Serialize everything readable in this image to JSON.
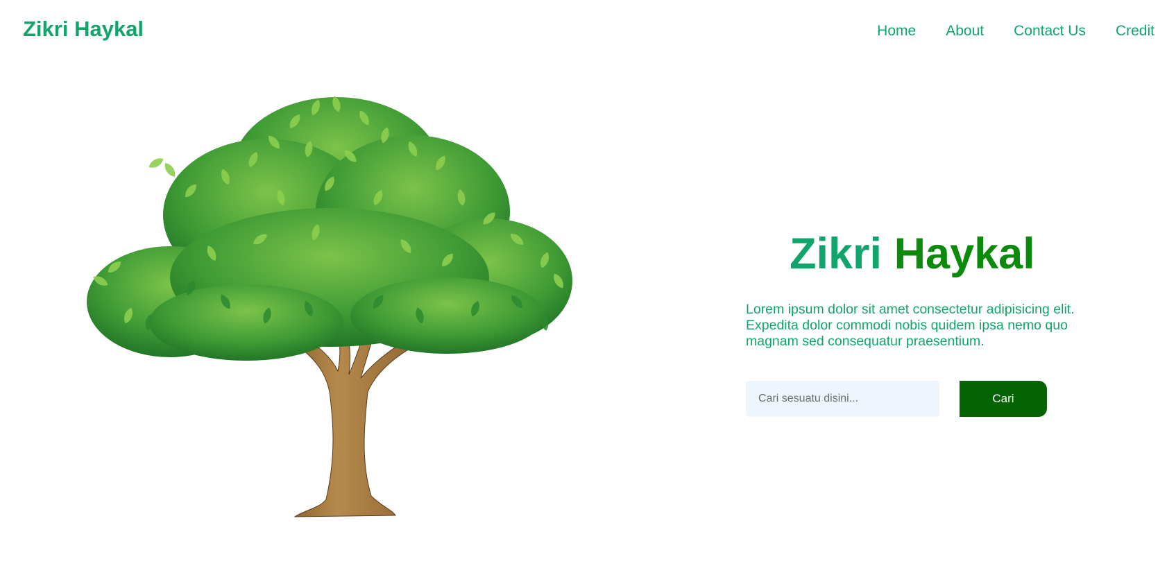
{
  "header": {
    "brand": "Zikri Haykal",
    "nav": [
      {
        "label": "Home"
      },
      {
        "label": "About"
      },
      {
        "label": "Contact Us"
      },
      {
        "label": "Credit"
      }
    ]
  },
  "hero": {
    "title_part1": "Zikri",
    "title_part2": "Haykal",
    "description": "Lorem ipsum dolor sit amet consectetur adipisicing elit. Expedita dolor commodi nobis quidem ipsa nemo quo magnam sed consequatur praesentium.",
    "search": {
      "placeholder": "Cari sesuatu disini...",
      "value": ""
    },
    "search_button_label": "Cari"
  },
  "colors": {
    "primary_green": "#12a56b",
    "title_green_dark": "#0b8a0b",
    "button_green": "#046404",
    "input_bg": "#eef5fd"
  },
  "images": {
    "hero_illustration": "tree-illustration"
  }
}
